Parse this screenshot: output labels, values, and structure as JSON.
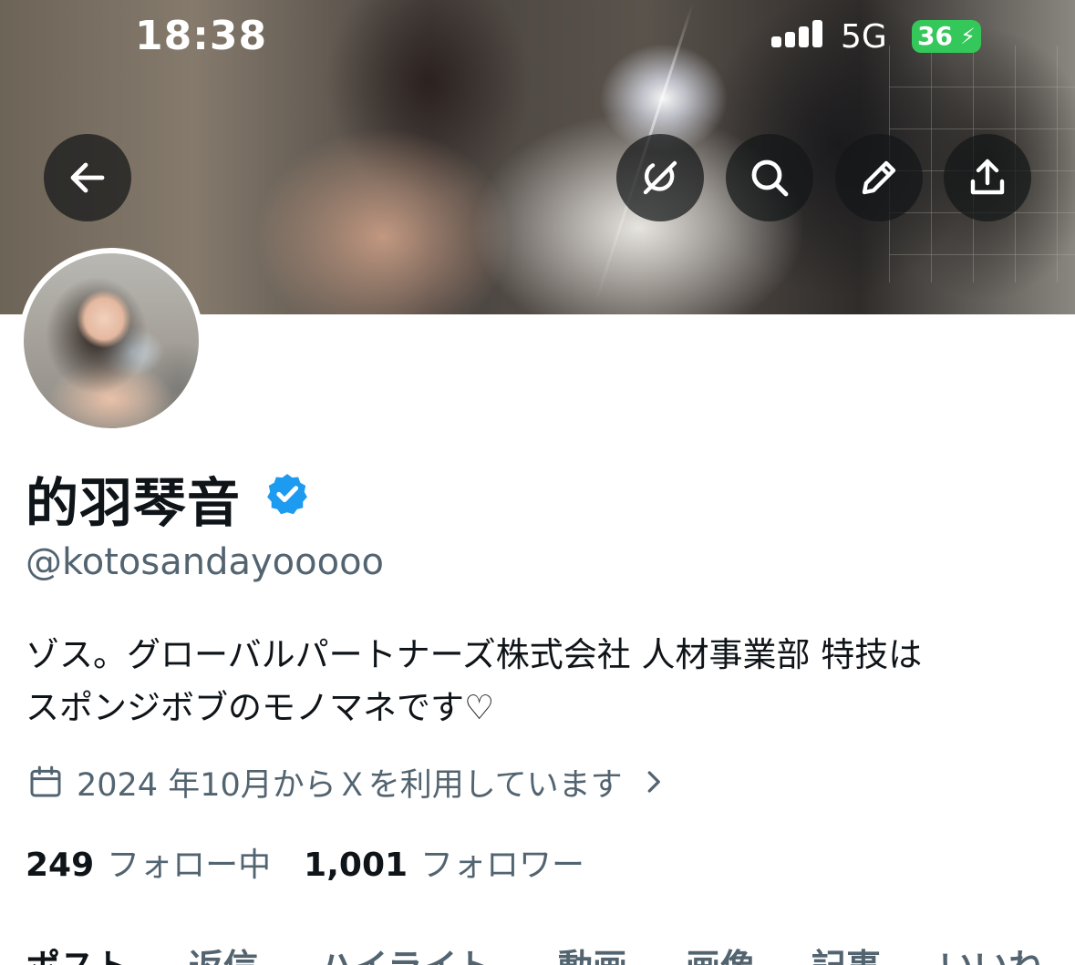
{
  "status_bar": {
    "time": "18:38",
    "network": "5G",
    "battery": "36"
  },
  "header": {
    "back_icon": "arrow-left-icon",
    "actions": [
      "grok-icon",
      "search-icon",
      "pencil-icon",
      "share-icon"
    ]
  },
  "profile": {
    "display_name": "的羽琴音",
    "verified": true,
    "handle": "@kotosandayooooo",
    "bio_lines": [
      "ゾス。グローバルパートナーズ株式会社 人材事業部 特技は",
      "スポンジボブのモノマネです♡"
    ],
    "joined": "2024 年10月からＸを利用しています",
    "following_count": "249",
    "following_label": "フォロー中",
    "followers_count": "1,001",
    "followers_label": "フォロワー"
  },
  "tabs": [
    {
      "label": "ポスト",
      "active": true
    },
    {
      "label": "返信",
      "active": false
    },
    {
      "label": "ハイライト",
      "active": false
    },
    {
      "label": "動画",
      "active": false
    },
    {
      "label": "画像",
      "active": false
    },
    {
      "label": "記事",
      "active": false
    },
    {
      "label": "いいね",
      "active": false
    }
  ],
  "colors": {
    "accent": "#1d9bf0",
    "text_primary": "#0f1419",
    "text_secondary": "#536471",
    "battery": "#34c759"
  }
}
